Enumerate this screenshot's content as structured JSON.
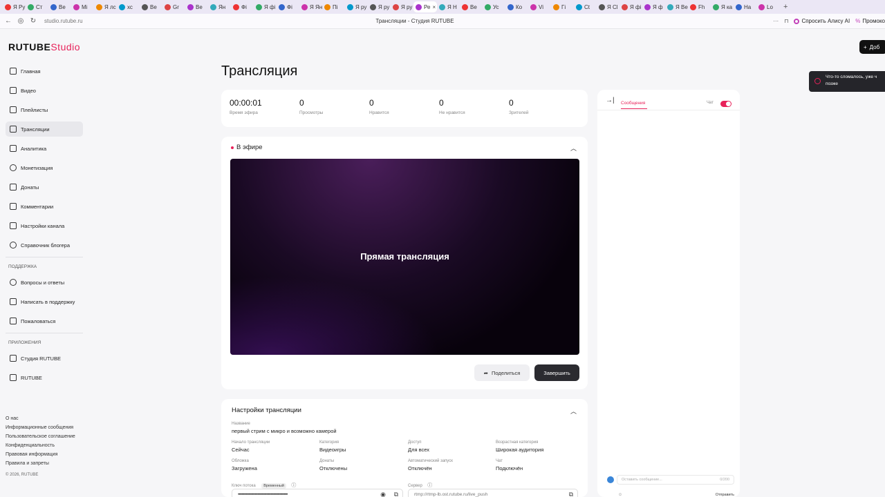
{
  "browser": {
    "tabs": [
      "Я Ру",
      "Ст",
      "Ве",
      "Мі",
      "Я лс",
      "хс",
      "Ве",
      "Gr",
      "Ве",
      "Ян",
      "Фі",
      "Я фі",
      "Фі",
      "Я Ян",
      "Пі",
      "Я ру",
      "Я ру",
      "Я ру",
      "Ре",
      "Я Н",
      "Ве",
      "Ус",
      "Ко",
      "Vi",
      "Гі",
      "Ct",
      "Я Cl",
      "Я фі",
      "Я ф",
      "Я Ве",
      "Fh",
      "Я ка",
      "На",
      "Lo"
    ],
    "active_tab": "Ре",
    "url": "studio.rutube.ru",
    "page_title": "Трансляции - Студия RUTUBE",
    "alice": "Спросить Алису AI",
    "promo": "Промоко",
    "add_button": "Доб"
  },
  "logo": {
    "main": "RUTUBE",
    "studio": "Studio"
  },
  "sidebar": {
    "items": [
      {
        "label": "Главная",
        "icon": "home-icon"
      },
      {
        "label": "Видео",
        "icon": "video-icon"
      },
      {
        "label": "Плейлисты",
        "icon": "playlist-icon"
      },
      {
        "label": "Трансляции",
        "icon": "broadcast-icon"
      },
      {
        "label": "Аналитика",
        "icon": "chart-icon"
      },
      {
        "label": "Монетизация",
        "icon": "money-icon"
      },
      {
        "label": "Донаты",
        "icon": "donate-icon"
      },
      {
        "label": "Комментарии",
        "icon": "comment-icon"
      },
      {
        "label": "Настройки канала",
        "icon": "gear-icon"
      },
      {
        "label": "Справочник блогера",
        "icon": "info-icon"
      }
    ],
    "support_head": "ПОДДЕРЖКА",
    "support": [
      {
        "label": "Вопросы и ответы"
      },
      {
        "label": "Написать в поддержку"
      },
      {
        "label": "Пожаловаться"
      }
    ],
    "apps_head": "ПРИЛОЖЕНИЯ",
    "apps": [
      {
        "label": "Студия RUTUBE"
      },
      {
        "label": "RUTUBE"
      }
    ],
    "footer": [
      "О нас",
      "Информационные сообщения",
      "Пользовательское соглашение",
      "Конфиденциальность",
      "Правовая информация",
      "Правила и запреты"
    ],
    "copyright": "© 2026, RUTUBE"
  },
  "page_title": "Трансляция",
  "stats": [
    {
      "value": "00:00:01",
      "label": "Время эфира"
    },
    {
      "value": "0",
      "label": "Просмотры"
    },
    {
      "value": "0",
      "label": "Нравится"
    },
    {
      "value": "0",
      "label": "Не нравится"
    },
    {
      "value": "0",
      "label": "Зрителей"
    }
  ],
  "live": {
    "header": "В эфире",
    "video_text": "Прямая трансляция",
    "share": "Поделиться",
    "end": "Завершить"
  },
  "settings": {
    "header": "Настройки трансляции",
    "name_label": "Название",
    "name_value": "первый стрим с микро и возможно камерой",
    "fields": [
      {
        "label": "Начало трансляции",
        "value": "Сейчас"
      },
      {
        "label": "Категория",
        "value": "Видеоигры"
      },
      {
        "label": "Доступ",
        "value": "Для всех"
      },
      {
        "label": "Возрастная категория",
        "value": "Широкая аудитория"
      },
      {
        "label": "Обложка",
        "value": "Загружена"
      },
      {
        "label": "Донаты",
        "value": "Отключены"
      },
      {
        "label": "Автоматический запуск",
        "value": "Отключён"
      },
      {
        "label": "Чат",
        "value": "Подключён"
      }
    ],
    "key_label": "Ключ потока",
    "key_badge": "Временный",
    "key_value": "••••••••••••••••••••••••••••••••••••••••••••••••••••••••",
    "server_label": "Сервер",
    "server_value": "rtmp://rtmp-lb.ost.rutube.ru/live_push"
  },
  "chat": {
    "tab": "Сообщения",
    "toggle_label": "Чат",
    "input_placeholder": "Оставить сообщение...",
    "counter": "0/200",
    "send": "Отправить"
  },
  "toast": {
    "text": "Что-то сломалось, уже ч позже"
  }
}
